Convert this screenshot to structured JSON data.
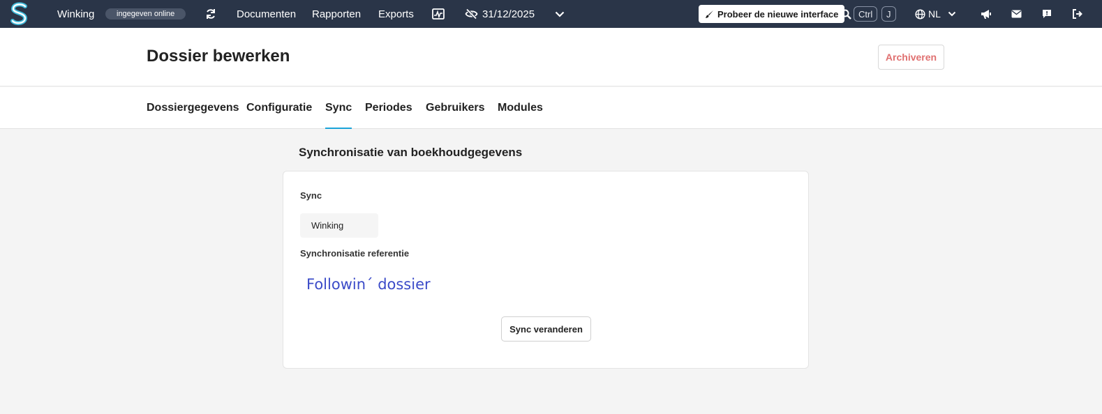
{
  "topbar": {
    "company": "Winking",
    "status": "ingegeven online",
    "nav_items": [
      "Documenten",
      "Rapporten",
      "Exports"
    ],
    "date": "31/12/2025",
    "try_new_interface": "Probeer de nieuwe interface",
    "shortcut_key1": "Ctrl",
    "shortcut_key2": "J",
    "language": "NL",
    "icons": [
      "logo",
      "refresh-icon",
      "chart-icon",
      "eye-slash-icon",
      "chevron-down-icon",
      "brush-icon",
      "search-icon",
      "globe-icon",
      "megaphone-icon",
      "mail-icon",
      "chat-icon",
      "logout-icon"
    ]
  },
  "header": {
    "title": "Dossier bewerken",
    "archive_label": "Archiveren"
  },
  "tabs": [
    {
      "label": "Dossiergegevens",
      "active": false
    },
    {
      "label": "Configuratie",
      "active": false
    },
    {
      "label": "Sync",
      "active": true
    },
    {
      "label": "Periodes",
      "active": false
    },
    {
      "label": "Gebruikers",
      "active": false
    },
    {
      "label": "Modules",
      "active": false
    }
  ],
  "content": {
    "section_title": "Synchronisatie van boekhoudgegevens",
    "sync_label": "Sync",
    "sync_value": "Winking",
    "reference_label": "Synchronisatie referentie",
    "reference_value": "Followin´ dossier",
    "change_button": "Sync veranderen"
  },
  "colors": {
    "topbar_bg": "#2a3548",
    "accent": "#1aa3d9",
    "archive_text": "#e07070",
    "reference_text": "#3b4bc8"
  }
}
